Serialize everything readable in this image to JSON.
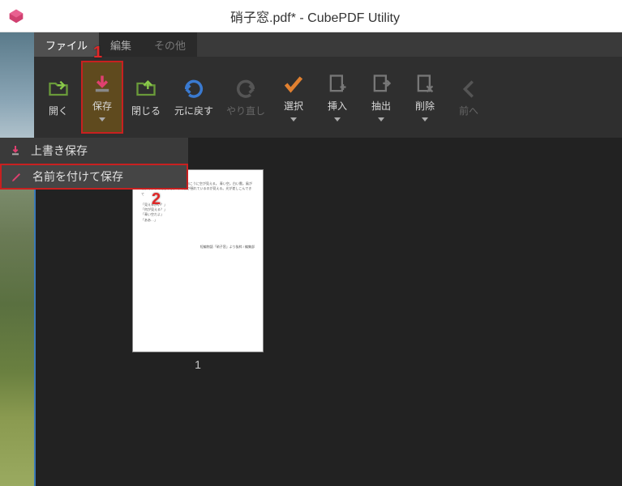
{
  "titlebar": {
    "title": "硝子窓.pdf* - CubePDF Utility"
  },
  "tabs": {
    "file": "ファイル",
    "edit": "編集",
    "other": "その他"
  },
  "ribbon": {
    "open": "開く",
    "save": "保存",
    "close": "閉じる",
    "undo": "元に戻す",
    "redo": "やり直し",
    "select": "選択",
    "insert": "挿入",
    "extract": "抽出",
    "delete": "削除",
    "prev": "前へ"
  },
  "dropdown": {
    "overwrite": "上書き保存",
    "saveas": "名前を付けて保存"
  },
  "annotations": {
    "n1": "1",
    "n2": "2"
  },
  "page": {
    "number": "1"
  }
}
